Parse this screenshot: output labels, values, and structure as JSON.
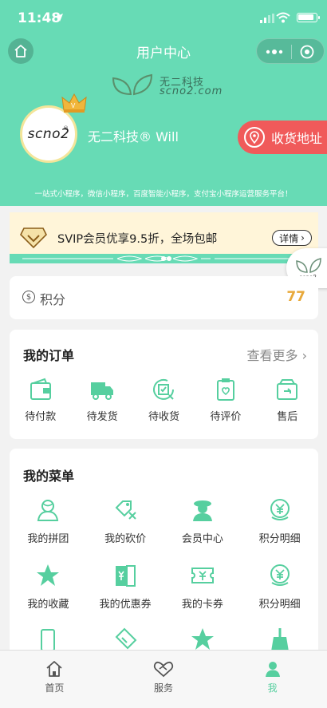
{
  "status_bar": {
    "time": "11:48"
  },
  "nav": {
    "title": "用户中心"
  },
  "brand": {
    "name_cn": "无二科技",
    "name_en": "scno2.com"
  },
  "user": {
    "avatar_text": "scno2",
    "avatar_mark": "®",
    "name": "无二科技® Will"
  },
  "address_button": {
    "label": "收货地址"
  },
  "slogan": "一站式小程序，微信小程序，百度智能小程序，支付宝小程序运营服务平台！",
  "svip": {
    "text": "SVIP会员优享9.5折，全场包邮",
    "detail_label": "详情"
  },
  "float_logo": {
    "text": "scno2"
  },
  "points": {
    "label": "积分",
    "value": "77"
  },
  "orders": {
    "title": "我的订单",
    "more_label": "查看更多",
    "items": [
      {
        "label": "待付款",
        "icon": "wallet-icon"
      },
      {
        "label": "待发货",
        "icon": "truck-icon"
      },
      {
        "label": "待收货",
        "icon": "receive-icon"
      },
      {
        "label": "待评价",
        "icon": "review-icon"
      },
      {
        "label": "售后",
        "icon": "after-sale-icon"
      }
    ]
  },
  "menu": {
    "title": "我的菜单",
    "items": [
      {
        "label": "我的拼团",
        "icon": "group-icon"
      },
      {
        "label": "我的砍价",
        "icon": "bargain-icon"
      },
      {
        "label": "会员中心",
        "icon": "member-icon"
      },
      {
        "label": "积分明细",
        "icon": "yen-coin-icon"
      },
      {
        "label": "我的收藏",
        "icon": "star-icon"
      },
      {
        "label": "我的优惠券",
        "icon": "coupon-icon"
      },
      {
        "label": "我的卡券",
        "icon": "card-voucher-icon"
      },
      {
        "label": "积分明细",
        "icon": "yen-coin-icon"
      },
      {
        "label": "",
        "icon": "phone-icon"
      },
      {
        "label": "",
        "icon": "tag-icon"
      },
      {
        "label": "",
        "icon": "star-icon"
      },
      {
        "label": "",
        "icon": "broom-icon"
      }
    ]
  },
  "tabbar": {
    "items": [
      {
        "label": "首页",
        "icon": "home-icon"
      },
      {
        "label": "服务",
        "icon": "handshake-icon"
      },
      {
        "label": "我",
        "icon": "user-icon"
      }
    ],
    "active_index": 2
  },
  "colors": {
    "theme": "#67dbb5",
    "accent": "#56cf9f",
    "address": "#f05a5a",
    "points": "#e8a93b"
  }
}
